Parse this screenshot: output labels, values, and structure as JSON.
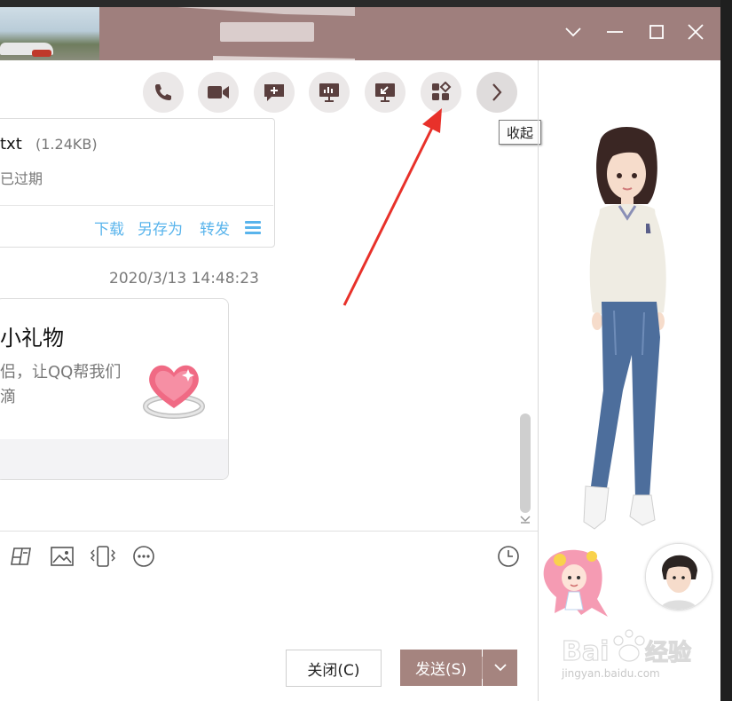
{
  "window": {
    "title_blurred": true,
    "controls": [
      "minimize-dropdown",
      "minimize",
      "maximize",
      "close"
    ]
  },
  "toolbar": {
    "buttons": [
      "phone-icon",
      "video-icon",
      "chat-plus-icon",
      "share-screen-icon",
      "remote-desktop-icon",
      "apps-icon",
      "chevron-right-icon"
    ],
    "tooltip": "收起"
  },
  "messages": {
    "file": {
      "name": "txt",
      "size": "(1.24KB)",
      "status": "已过期",
      "actions": {
        "download": "下载",
        "save_as": "另存为",
        "forward": "转发"
      }
    },
    "timestamp": "2020/3/13 14:48:23",
    "gift": {
      "title": "小礼物",
      "desc_line1": "侣，让QQ帮我们",
      "desc_line2": "滴"
    }
  },
  "input_toolbar": {
    "icons": [
      "screenshot-icon",
      "image-icon",
      "vibrate-icon",
      "more-icon",
      "history-clock-icon"
    ]
  },
  "actions": {
    "close_label": "关闭(C)",
    "send_label": "发送(S)"
  },
  "watermark": {
    "brand": "Bai经验",
    "url": "jingyan.baidu.com"
  },
  "colors": {
    "titlebar": "#9f7f7d",
    "send_button": "#a5847f",
    "link": "#59b4ec",
    "annotation_arrow": "#e8312a"
  }
}
